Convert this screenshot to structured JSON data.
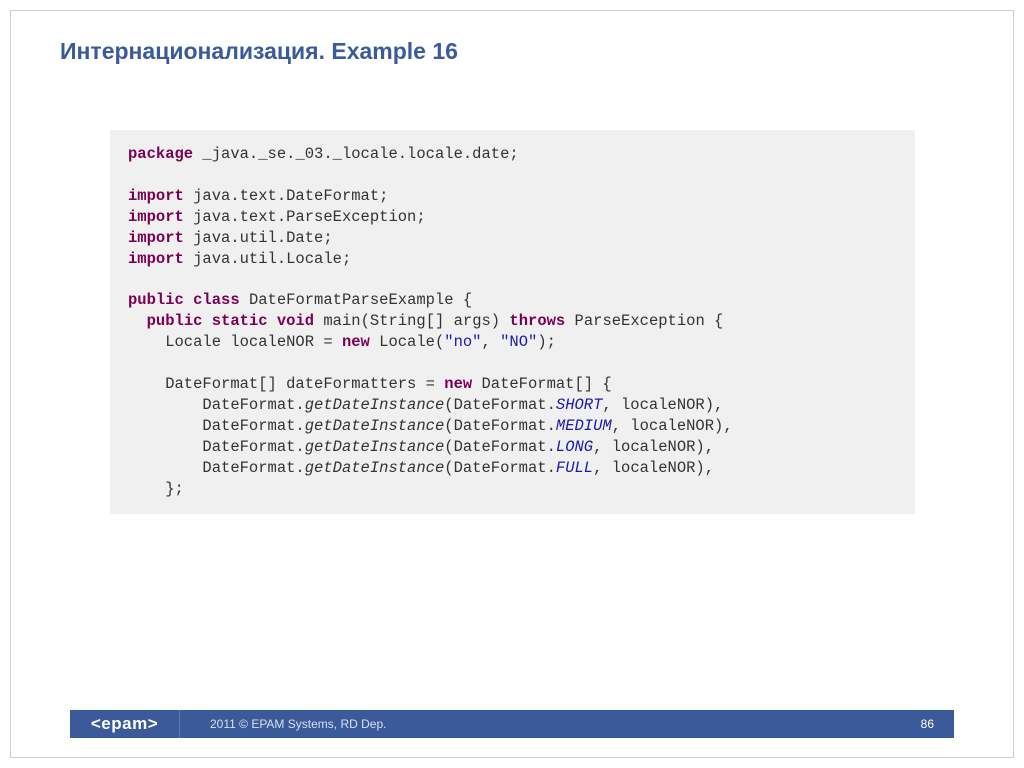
{
  "title": "Интернационализация. Example 16",
  "code": {
    "package_kw": "package",
    "package_name": " _java._se._03._locale.locale.date;",
    "import_kw": "import",
    "import1": " java.text.DateFormat;",
    "import2": " java.text.ParseException;",
    "import3": " java.util.Date;",
    "import4": " java.util.Locale;",
    "public_kw": "public",
    "class_kw": "class",
    "class_name": " DateFormatParseExample {",
    "static_kw": "static",
    "void_kw": "void",
    "main_sig": " main(String[] args) ",
    "throws_kw": "throws",
    "throws_ex": " ParseException {",
    "locale_line1": "    Locale localeNOR = ",
    "new_kw": "new",
    "locale_line2": " Locale(",
    "str_no": "\"no\"",
    "comma": ", ",
    "str_NO": "\"NO\"",
    "locale_line3": ");",
    "df_line1": "    DateFormat[] dateFormatters = ",
    "df_line2": " DateFormat[] {",
    "df_call1a": "        DateFormat.",
    "getDateInstance": "getDateInstance",
    "df_call1b": "(DateFormat.",
    "SHORT": "SHORT",
    "df_suffix": ", localeNOR),",
    "MEDIUM": "MEDIUM",
    "LONG": "LONG",
    "FULL": "FULL",
    "close_brace": "    };"
  },
  "footer": {
    "logo": "<epam>",
    "copyright": "2011 © EPAM Systems, RD Dep.",
    "page": "86"
  }
}
